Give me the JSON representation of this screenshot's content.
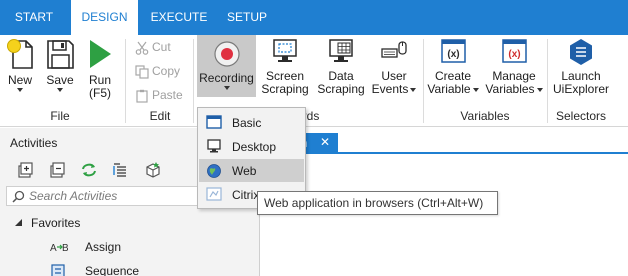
{
  "tabs": [
    {
      "label": "START",
      "active": false
    },
    {
      "label": "DESIGN",
      "active": true
    },
    {
      "label": "EXECUTE",
      "active": false
    },
    {
      "label": "SETUP",
      "active": false
    }
  ],
  "ribbon": {
    "file": {
      "label": "File",
      "new_label": "New",
      "save_label": "Save",
      "run_label": "Run",
      "run_shortcut": "(F5)"
    },
    "edit": {
      "label": "Edit",
      "cut_label": "Cut",
      "copy_label": "Copy",
      "paste_label": "Paste"
    },
    "wizards": {
      "label_visible": "ards",
      "recording_label": "Recording",
      "screen_scraping_line1": "Screen",
      "screen_scraping_line2": "Scraping",
      "data_scraping_line1": "Data",
      "data_scraping_line2": "Scraping",
      "user_events_line1": "User",
      "user_events_line2": "Events"
    },
    "variables": {
      "label": "Variables",
      "create_line1": "Create",
      "create_line2": "Variable",
      "manage_line1": "Manage",
      "manage_line2": "Variables"
    },
    "selectors": {
      "label": "Selectors",
      "launch_line1": "Launch",
      "launch_line2": "UiExplorer"
    }
  },
  "activities_panel": {
    "title": "Activities",
    "search_placeholder": "Search Activities",
    "tree": [
      {
        "label": "Favorites",
        "expanded": true
      },
      {
        "label": "Assign",
        "icon": "assign-icon"
      },
      {
        "label": "Sequence",
        "icon": "sequence-icon"
      }
    ]
  },
  "document_tab": {
    "label_visible": "in",
    "close_glyph": "✕"
  },
  "recording_menu": {
    "items": [
      {
        "label": "Basic",
        "icon": "basic-recorder-icon",
        "hover": false
      },
      {
        "label": "Desktop",
        "icon": "desktop-recorder-icon",
        "hover": false
      },
      {
        "label": "Web",
        "icon": "web-recorder-icon",
        "hover": true
      },
      {
        "label": "Citrix",
        "icon": "citrix-recorder-icon",
        "hover": false
      }
    ]
  },
  "tooltip": {
    "text": "Web application in browsers (Ctrl+Alt+W)"
  },
  "colors": {
    "accent": "#1f7fd1",
    "run_green": "#2ea043",
    "record_red": "#e03040",
    "variable_red": "#d02c2c"
  }
}
